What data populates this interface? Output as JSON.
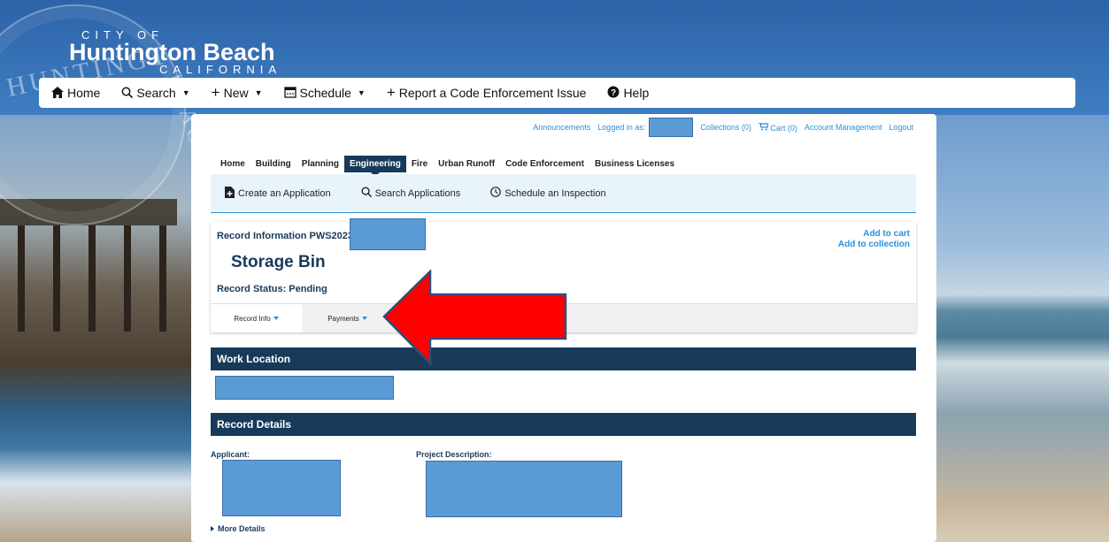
{
  "branding": {
    "city_of": "CITY OF",
    "city_name": "Huntington Beach",
    "state": "CALIFORNIA"
  },
  "top_nav": [
    {
      "label": "Home",
      "icon": "home-icon",
      "glyph": "⌂",
      "caret": false
    },
    {
      "label": "Search",
      "icon": "search-icon",
      "glyph": "⌕",
      "caret": true
    },
    {
      "label": "New",
      "icon": "plus-icon",
      "glyph": "+",
      "caret": true
    },
    {
      "label": "Schedule",
      "icon": "calendar-icon",
      "glyph": "▦",
      "caret": true
    },
    {
      "label": "Report a Code Enforcement Issue",
      "icon": "plus-icon",
      "glyph": "+",
      "caret": false
    },
    {
      "label": "Help",
      "icon": "help-icon",
      "glyph": "❓",
      "caret": false
    }
  ],
  "utility": {
    "announcements": "Announcements",
    "logged_in": "Logged in as:",
    "collections": "Collections (0)",
    "cart": "Cart (0)",
    "account": "Account Management",
    "logout": "Logout"
  },
  "module_tabs": [
    "Home",
    "Building",
    "Planning",
    "Engineering",
    "Fire",
    "Urban Runoff",
    "Code Enforcement",
    "Business Licenses"
  ],
  "active_module": "Engineering",
  "sub_nav": [
    {
      "label": "Create an Application",
      "icon": "document-add-icon"
    },
    {
      "label": "Search Applications",
      "icon": "search-icon"
    },
    {
      "label": "Schedule an Inspection",
      "icon": "clock-icon"
    }
  ],
  "record": {
    "info_label": "Record Information PWS2023",
    "add_to_cart": "Add to cart",
    "add_to_collection": "Add to collection",
    "title": "Storage Bin",
    "status": "Record Status: Pending",
    "tabs": [
      "Record Info",
      "Payments"
    ]
  },
  "sections": {
    "work_location": "Work Location",
    "record_details": "Record Details",
    "applicant": "Applicant:",
    "project_description": "Project Description:",
    "more_details": "More Details"
  },
  "colors": {
    "navy": "#183a5a",
    "link_blue": "#2b8fd6",
    "redaction": "#5b9bd5",
    "arrow_red": "#ff0000"
  }
}
